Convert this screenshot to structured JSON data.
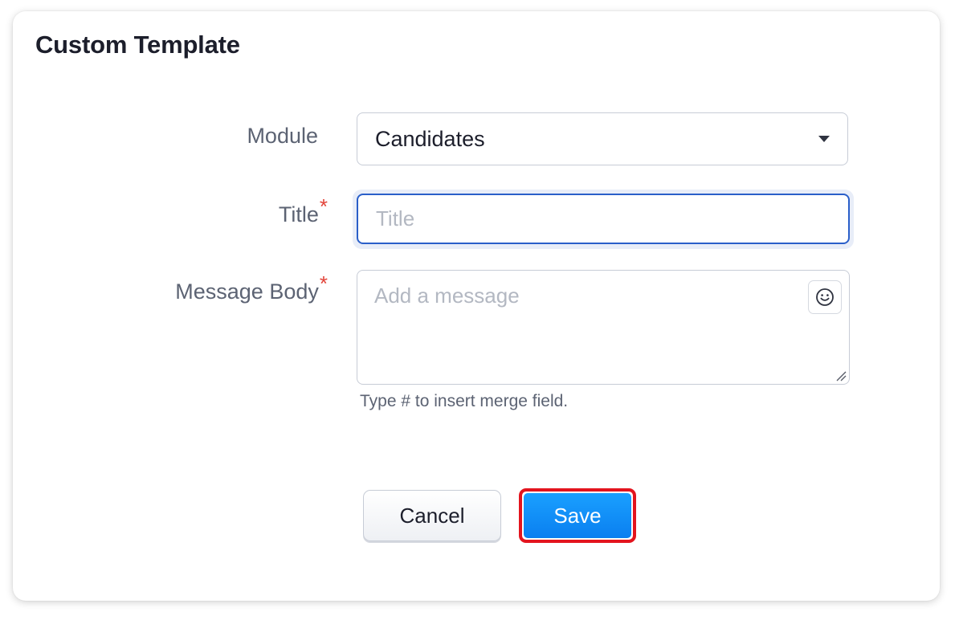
{
  "dialog": {
    "title": "Custom Template"
  },
  "form": {
    "module": {
      "label": "Module",
      "selected": "Candidates"
    },
    "title": {
      "label": "Title",
      "required_mark": "*",
      "value": "",
      "placeholder": "Title"
    },
    "message_body": {
      "label": "Message Body",
      "required_mark": "*",
      "value": "",
      "placeholder": "Add a message",
      "hint": "Type # to insert merge field."
    }
  },
  "actions": {
    "cancel_label": "Cancel",
    "save_label": "Save"
  },
  "icons": {
    "dropdown": "chevron-down-icon",
    "emoji": "smiley-icon",
    "resize": "resize-handle-icon"
  },
  "colors": {
    "primary": "#0a7ff0",
    "focus_border": "#2a5fc9",
    "required": "#e2443a",
    "highlight": "#e3141e"
  }
}
